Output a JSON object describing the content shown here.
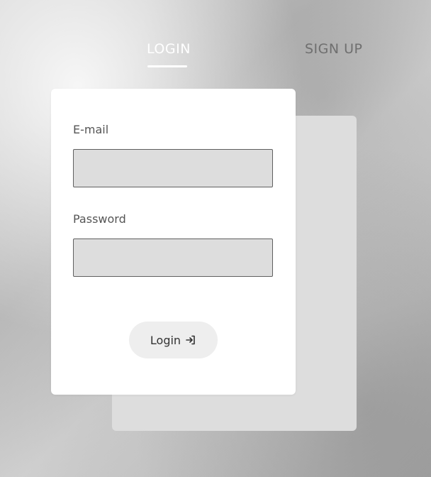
{
  "tabs": {
    "login": "LOGIN",
    "signup": "SIGN UP",
    "active": "login"
  },
  "form": {
    "email_label": "E-mail",
    "email_value": "",
    "password_label": "Password",
    "password_value": "",
    "submit_label": "Login",
    "submit_icon": "login-arrow-icon"
  },
  "colors": {
    "active_tab": "#ffffff",
    "inactive_tab": "#6f6f6f",
    "input_bg": "#dddddd",
    "button_bg": "#eeeeee",
    "card_bg": "#ffffff",
    "back_card_bg": "#dddddd"
  }
}
